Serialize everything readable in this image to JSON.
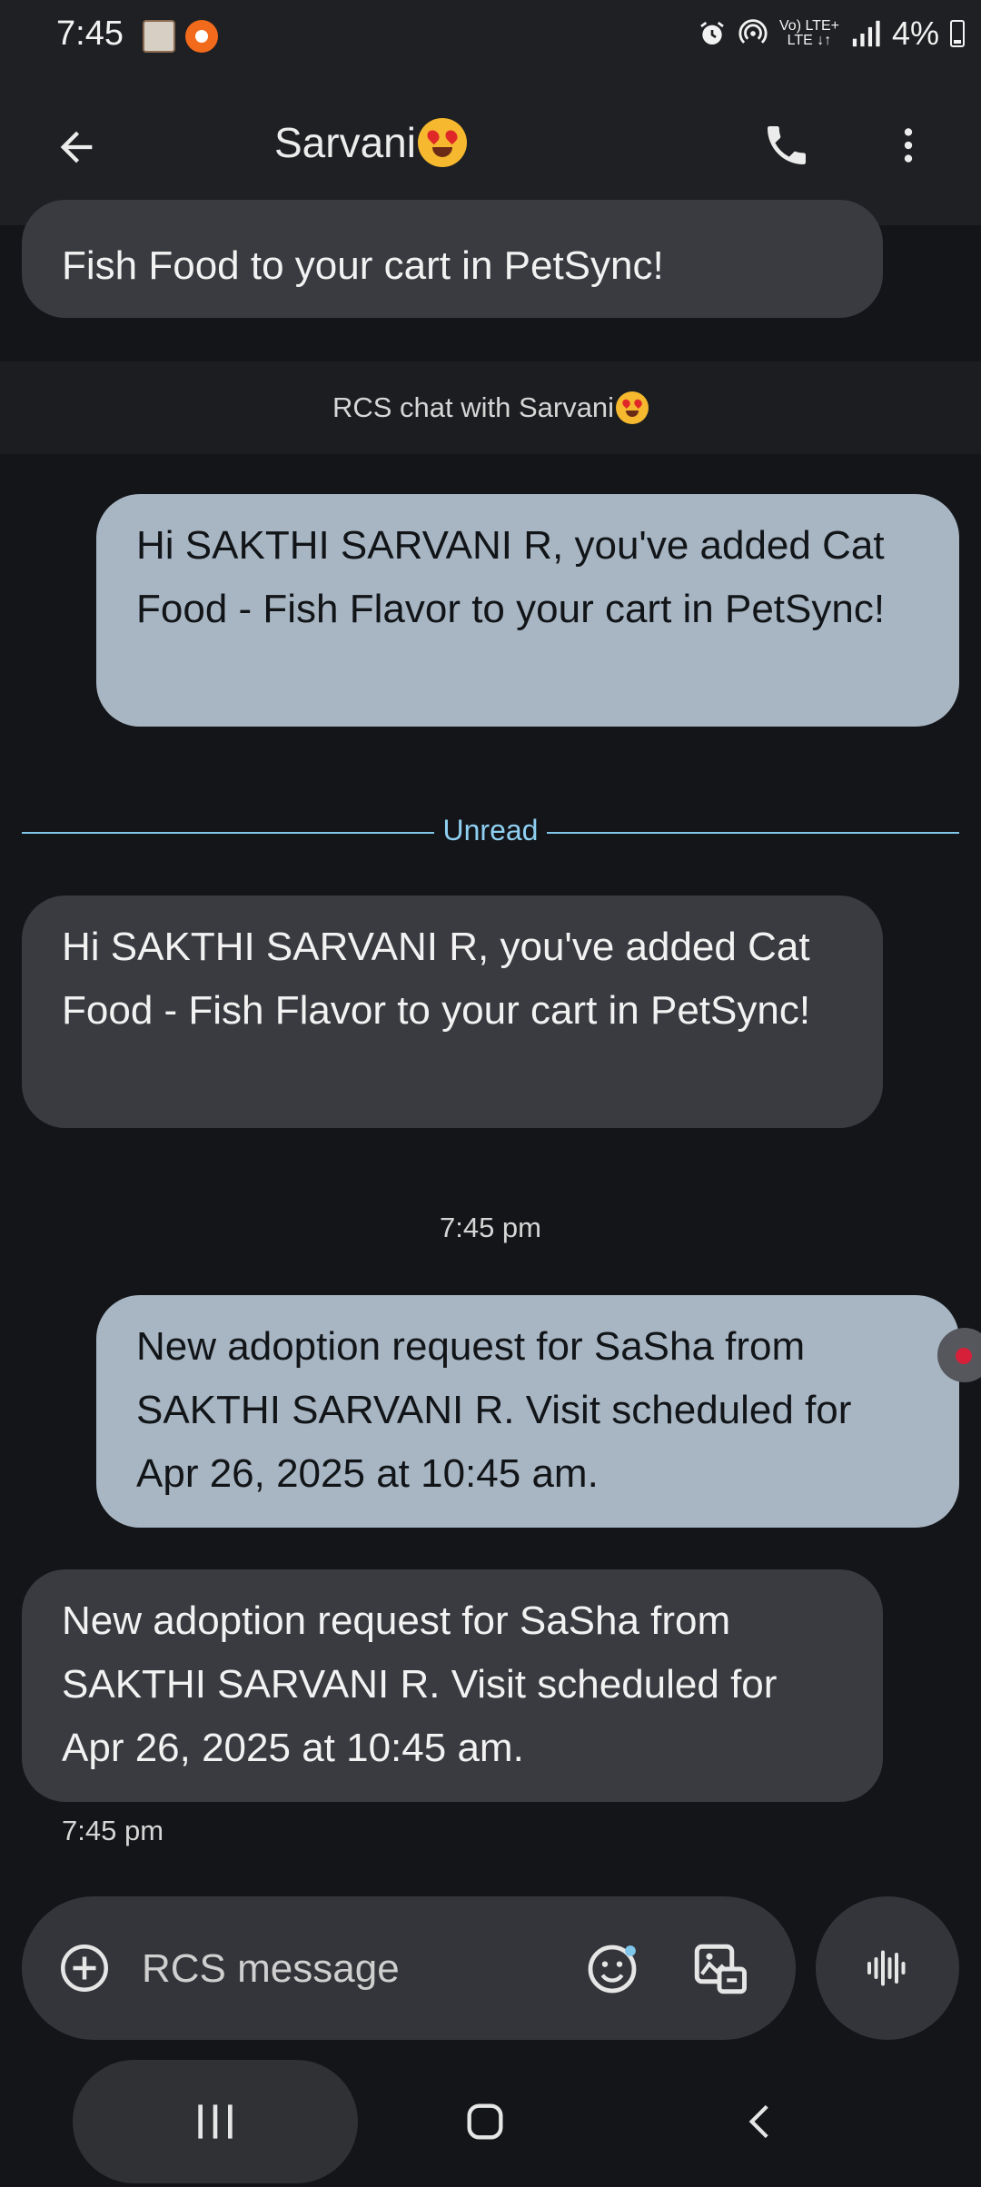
{
  "status_bar": {
    "time": "7:45",
    "battery": "4%",
    "network_top": "Vo) LTE+",
    "network_bottom": "LTE ↓↑"
  },
  "header": {
    "contact_name": "Sarvani"
  },
  "conversation": {
    "partial_message": "Fish Food to your cart in PetSync!",
    "rcs_banner": "RCS chat with Sarvani",
    "unread_label": "Unread",
    "messages": [
      {
        "direction": "outgoing",
        "text": "Hi SAKTHI SARVANI R, you've added Cat Food - Fish Flavor to your cart in PetSync!"
      },
      {
        "direction": "incoming",
        "text": "Hi SAKTHI SARVANI R, you've added Cat Food - Fish Flavor to your cart in PetSync!"
      },
      {
        "direction": "outgoing",
        "text": "New adoption request for SaSha from SAKTHI SARVANI R. Visit scheduled for Apr 26, 2025 at 10:45 am."
      },
      {
        "direction": "incoming",
        "text": "New adoption request for SaSha from SAKTHI SARVANI R. Visit scheduled for Apr 26, 2025 at 10:45 am."
      }
    ],
    "timestamp_center": "7:45 pm",
    "timestamp_last": "7:45 pm"
  },
  "compose": {
    "placeholder": "RCS message"
  },
  "colors": {
    "background": "#141518",
    "app_bar": "#1f2023",
    "incoming_bubble": "#3a3b40",
    "outgoing_bubble": "#a8b6c4",
    "unread_accent": "#7fc6ea"
  },
  "icons": {
    "back": "arrow-left-icon",
    "call": "phone-icon",
    "more": "more-vert-icon",
    "add": "add-circle-icon",
    "emoji": "emoji-icon",
    "gallery": "gallery-icon",
    "voice": "voice-wave-icon"
  }
}
